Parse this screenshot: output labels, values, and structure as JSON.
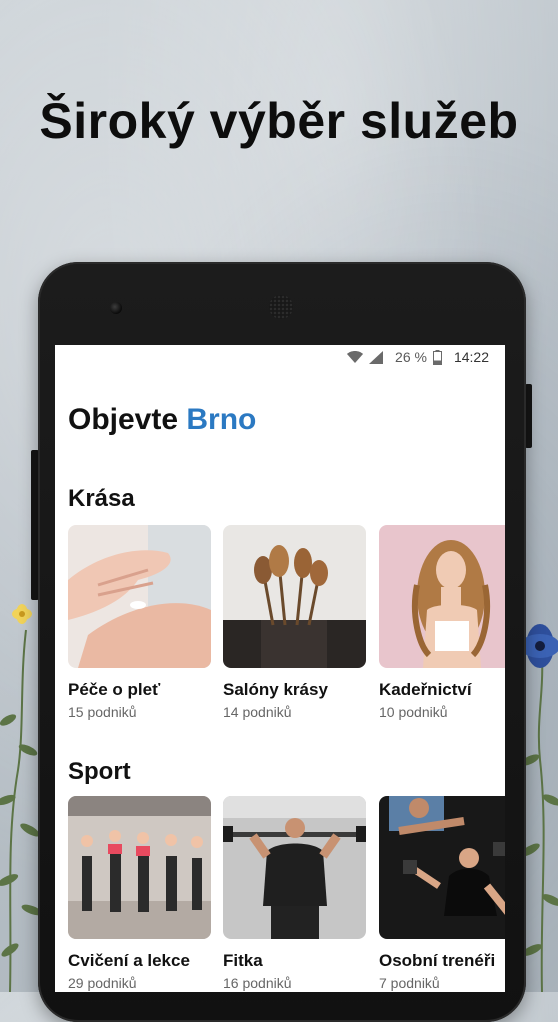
{
  "headline": "Široký výběr služeb",
  "status_bar": {
    "battery_text": "26 %",
    "time": "14:22",
    "icons": [
      "wifi-icon",
      "signal-icon",
      "battery-icon"
    ]
  },
  "page": {
    "title_prefix": "Objevte",
    "title_city": "Brno"
  },
  "sections": [
    {
      "title": "Krása",
      "cards": [
        {
          "title": "Péče o pleť",
          "subtitle": "15 podniků",
          "image": "skincare-photo"
        },
        {
          "title": "Salóny krásy",
          "subtitle": "14 podniků",
          "image": "makeup-brushes-photo"
        },
        {
          "title": "Kadeřnictví",
          "subtitle": "10 podniků",
          "image": "curly-hair-woman-photo"
        }
      ]
    },
    {
      "title": "Sport",
      "cards": [
        {
          "title": "Cvičení a lekce",
          "subtitle": "29 podniků",
          "image": "group-fitness-class-photo"
        },
        {
          "title": "Fitka",
          "subtitle": "16 podniků",
          "image": "barbell-squat-photo"
        },
        {
          "title": "Osobní trenéři",
          "subtitle": "7 podniků",
          "image": "personal-trainer-photo"
        }
      ]
    }
  ],
  "colors": {
    "accent": "#2b79c2",
    "text": "#111111",
    "muted": "#666666",
    "background": "#ffffff"
  }
}
